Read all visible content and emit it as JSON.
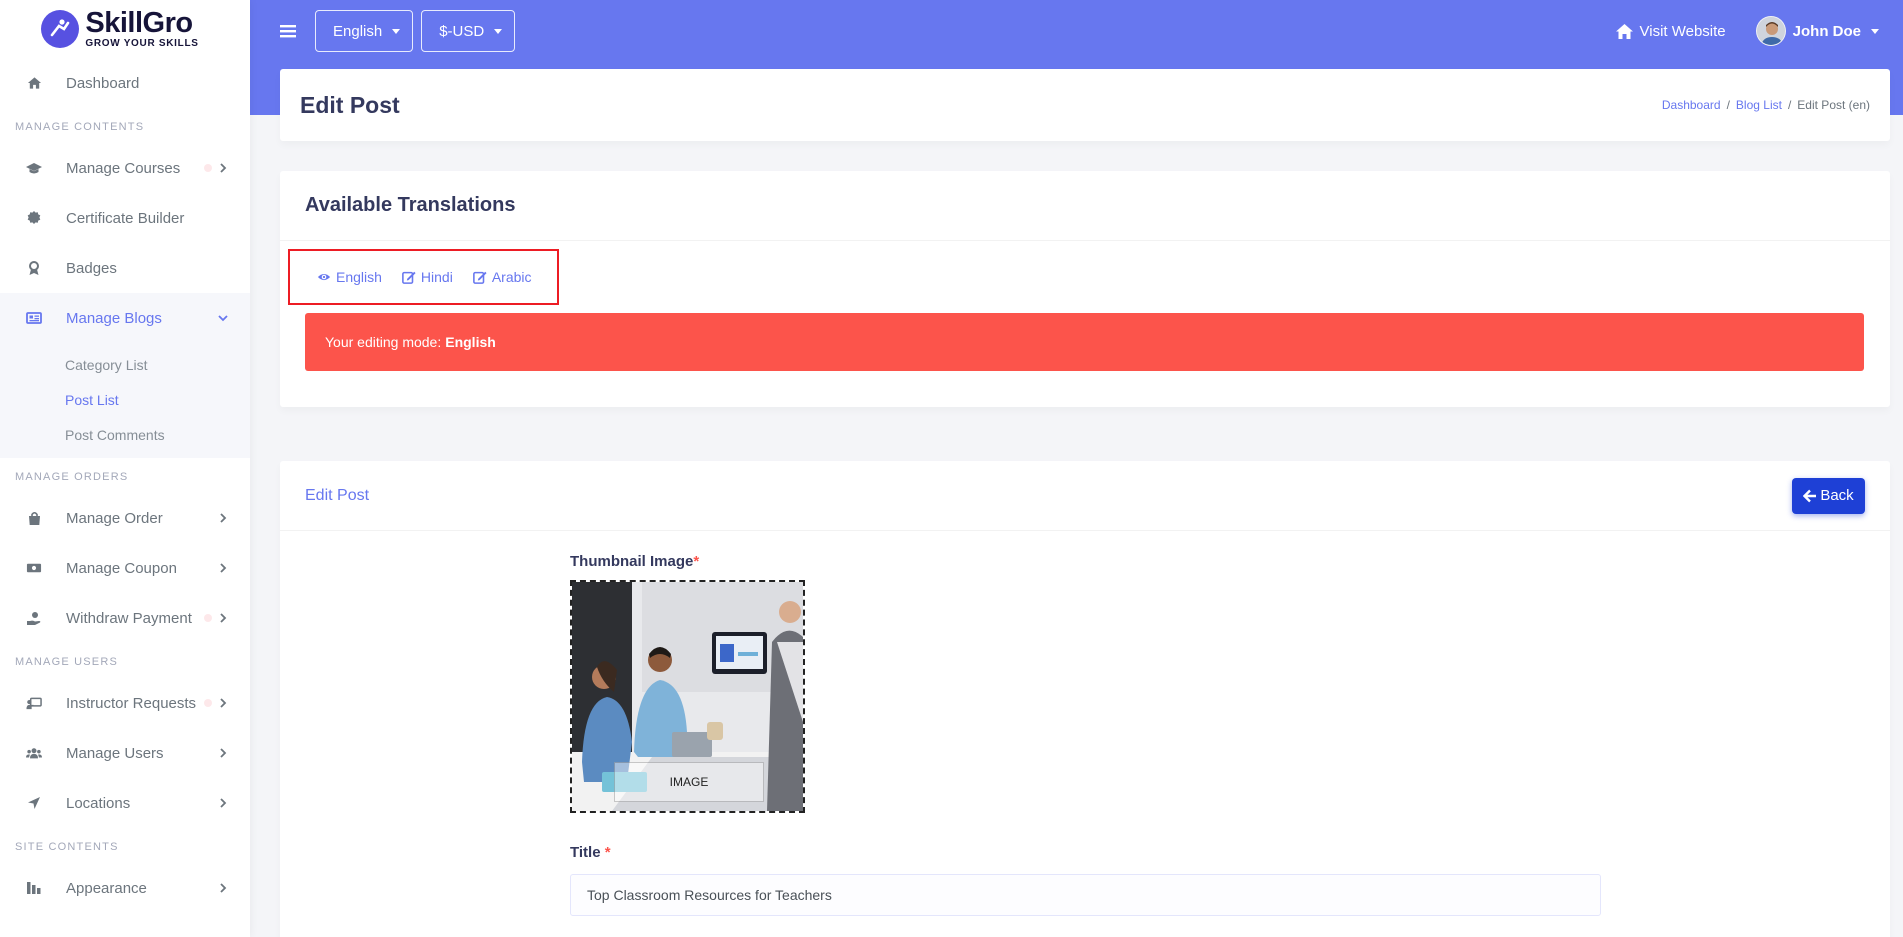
{
  "brand": {
    "name": "SkillGro",
    "tagline": "GROW YOUR SKILLS"
  },
  "sidebar": {
    "dashboard": "Dashboard",
    "section_contents": "MANAGE CONTENTS",
    "manage_courses": "Manage Courses",
    "certificate_builder": "Certificate Builder",
    "badges": "Badges",
    "manage_blogs": "Manage Blogs",
    "blog_sub": [
      "Category List",
      "Post List",
      "Post Comments"
    ],
    "section_orders": "MANAGE ORDERS",
    "manage_order": "Manage Order",
    "manage_coupon": "Manage Coupon",
    "withdraw_payment": "Withdraw Payment",
    "section_users": "MANAGE USERS",
    "instructor_requests": "Instructor Requests",
    "manage_users": "Manage Users",
    "locations": "Locations",
    "section_site": "SITE CONTENTS",
    "appearance": "Appearance"
  },
  "topbar": {
    "language": "English",
    "currency": "$-USD",
    "visit_website": "Visit Website",
    "user_name": "John Doe"
  },
  "header": {
    "title": "Edit Post",
    "breadcrumb": [
      "Dashboard",
      "Blog List",
      "Edit Post (en)"
    ]
  },
  "translations": {
    "title": "Available Translations",
    "languages": [
      "English",
      "Hindi",
      "Arabic"
    ],
    "alert_prefix": "Your editing mode:",
    "alert_lang": "English"
  },
  "edit_form": {
    "title": "Edit Post",
    "back_label": "Back",
    "thumbnail_label": "Thumbnail Image",
    "thumbnail_caption": "IMAGE",
    "title_label": "Title",
    "required_mark": "*",
    "title_value": "Top Classroom Resources for Teachers"
  },
  "colors": {
    "primary": "#6777ef",
    "danger": "#fc544b",
    "back_button": "#1e40d6",
    "highlight_border": "#ed1c24"
  }
}
